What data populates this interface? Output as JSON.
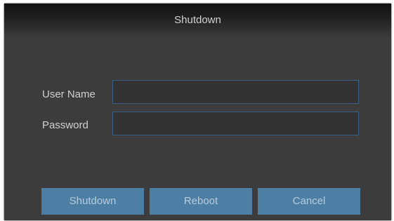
{
  "dialog": {
    "title": "Shutdown"
  },
  "form": {
    "username_label": "User Name",
    "username_value": "",
    "password_label": "Password",
    "password_value": ""
  },
  "buttons": {
    "shutdown": "Shutdown",
    "reboot": "Reboot",
    "cancel": "Cancel"
  },
  "colors": {
    "dialog_bg": "#3c3c3c",
    "input_border": "#3c5d88",
    "button_bg": "#4d7fa5",
    "button_text": "#b6cbdd"
  }
}
